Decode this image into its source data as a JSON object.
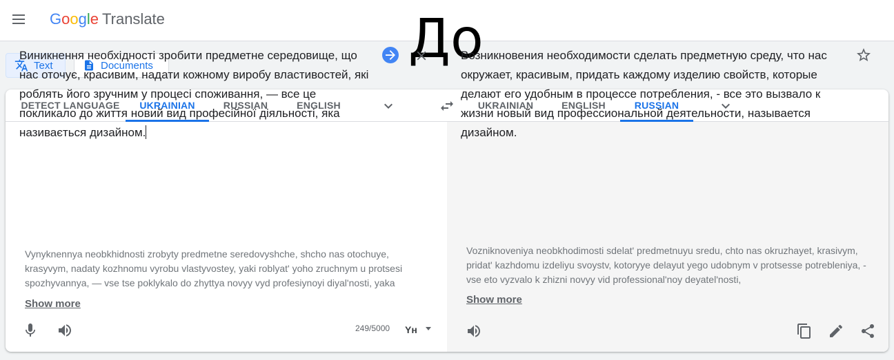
{
  "header": {
    "logo_letters": [
      "G",
      "o",
      "o",
      "g",
      "l",
      "e"
    ],
    "logo_colors": [
      "#4285f4",
      "#ea4335",
      "#fbbc05",
      "#4285f4",
      "#34a853",
      "#ea4335"
    ],
    "product": "Translate"
  },
  "overlay_text": "До",
  "modes": {
    "text": "Text",
    "documents": "Documents"
  },
  "source_tabs": [
    "DETECT LANGUAGE",
    "UKRAINIAN",
    "RUSSIAN",
    "ENGLISH"
  ],
  "source_active": "UKRAINIAN",
  "target_tabs": [
    "UKRAINIAN",
    "ENGLISH",
    "RUSSIAN"
  ],
  "target_active": "RUSSIAN",
  "source": {
    "text": "Виникнення необхідності зробити предметне середовище, що нас оточує, красивим, надати кожному виробу властивостей, які роблять його зручним у процесі споживання, — все це покликало до життя новий вид професійної діяльності, яка називається дизайном.",
    "transliteration": "Vynyknennya neobkhidnosti zrobyty predmetne seredovyshche, shcho nas otochuye, krasyvym, nadaty kozhnomu vyrobu vlastyvostey, yaki roblyatʹ yoho zruchnym u protsesi spozhyvannya, — vse tse poklykalo do zhyttya novyy vyd profesiynoyi diyalʹnosti, yaka",
    "show_more": "Show more",
    "char_count": "249/5000",
    "keyboard_label": "Yн"
  },
  "target": {
    "text": "Возникновения необходимости сделать предметную среду, что нас окружает, красивым, придать каждому изделию свойств, которые делают его удобным в процессе потребления, - все это вызвало к жизни новый вид профессиональной деятельности, называется дизайном.",
    "transliteration": "Vozniknoveniya neobkhodimosti sdelat' predmetnuyu sredu, chto nas okruzhayet, krasivym, pridat' kazhdomu izdeliyu svoystv, kotoryye delayut yego udobnym v protsesse potrebleniya, - vse eto vyzvalo k zhizni novyy vid professional'noy deyatel'nosti,",
    "show_more": "Show more"
  },
  "colors": {
    "accent": "#1a73e8",
    "go_button": "#4285f4",
    "icon": "#5f6368"
  }
}
